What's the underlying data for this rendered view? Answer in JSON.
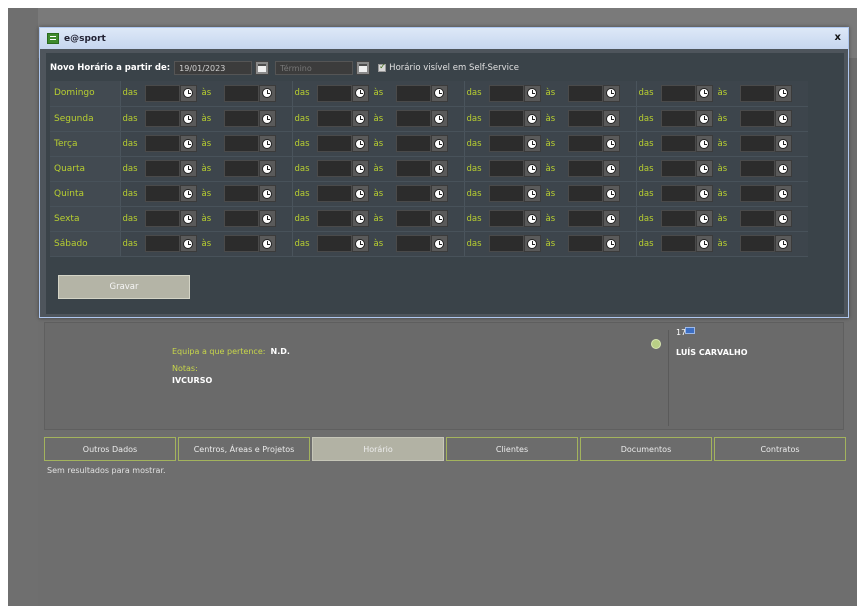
{
  "dialog": {
    "title": "e@sport",
    "close_label": "x",
    "heading": "Novo Horário a partir de:",
    "date_value": "19/01/2023",
    "end_placeholder": "Término",
    "visible_label": "Horário visível em Self-Service",
    "visible_checked": true,
    "from_label": "das",
    "to_label": "às",
    "days": [
      "Domingo",
      "Segunda",
      "Terça",
      "Quarta",
      "Quinta",
      "Sexta",
      "Sábado"
    ],
    "save_label": "Gravar"
  },
  "profile": {
    "team_label": "Equipa a que pertence:",
    "team_value": "N.D.",
    "notes_label": "Notas:",
    "notes_value": "IVCURSO",
    "badge_number": "17",
    "person_name": "LUÍS CARVALHO"
  },
  "tabs": [
    "Outros Dados",
    "Centros, Áreas e Projetos",
    "Horário",
    "Clientes",
    "Documentos",
    "Contratos"
  ],
  "active_tab": "Horário",
  "empty_message": "Sem resultados para mostrar.",
  "colors": {
    "accent_green": "#b8cf30",
    "titlebar": "#c6d6ef",
    "active_tab": "#b2b2a4"
  }
}
